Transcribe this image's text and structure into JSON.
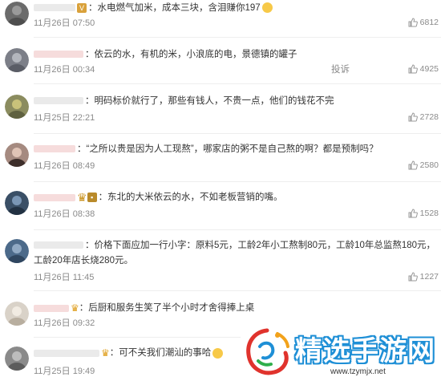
{
  "colors": {
    "accent": "#1e8fd6",
    "meta": "#8a8a8a",
    "text": "#333333"
  },
  "report_label": "投诉",
  "comments": [
    {
      "text": "：水电燃气加米，成本三块，含泪赚你197",
      "text2": "",
      "date": "11月26日 07:50",
      "likes": "6812",
      "avatar_color": "#6b6b6b"
    },
    {
      "text": "：依云的水，有机的米，小浪底的电，景德镇的罐子",
      "text2": "",
      "date": "11月26日 00:34",
      "likes": "4925",
      "avatar_color": "#7c7f88"
    },
    {
      "text": "：明码标价就行了，那些有钱人，不贵一点，他们的钱花不完",
      "text2": "",
      "date": "11月25日 22:21",
      "likes": "2728",
      "avatar_color": "#8b8c5f"
    },
    {
      "text": "：“之所以贵是因为人工现熬”，哪家店的粥不是自己熬的啊？都是预制吗？",
      "text2": "",
      "date": "11月26日 08:49",
      "likes": "2580",
      "avatar_color": "#a58a80"
    },
    {
      "text": "：东北的大米依云的水，不如老板营销的嘴。",
      "text2": "",
      "date": "11月26日 08:38",
      "likes": "1528",
      "avatar_color": "#3a4f66"
    },
    {
      "text": "：价格下面应加一行小字：原料5元，工龄2年小工熬制80元，工龄10年总监熬180元，",
      "text2": "工龄20年店长烧280元。",
      "date": "11月26日 11:45",
      "likes": "1227",
      "avatar_color": "#4c6a8a"
    },
    {
      "text": "：后厨和服务生笑了半个小时才舍得捧上桌",
      "text2": "",
      "date": "11月26日 09:32",
      "likes": "",
      "avatar_color": "#d9d2c8"
    },
    {
      "text": "：可不关我们潮汕的事哈",
      "text2": "",
      "date": "11月25日 19:49",
      "likes": "",
      "avatar_color": "#8a8a8a"
    }
  ],
  "watermark": {
    "title": "精选手游网",
    "url": "www.tzymjx.net",
    "logo_icon": "swirl-logo-icon"
  }
}
